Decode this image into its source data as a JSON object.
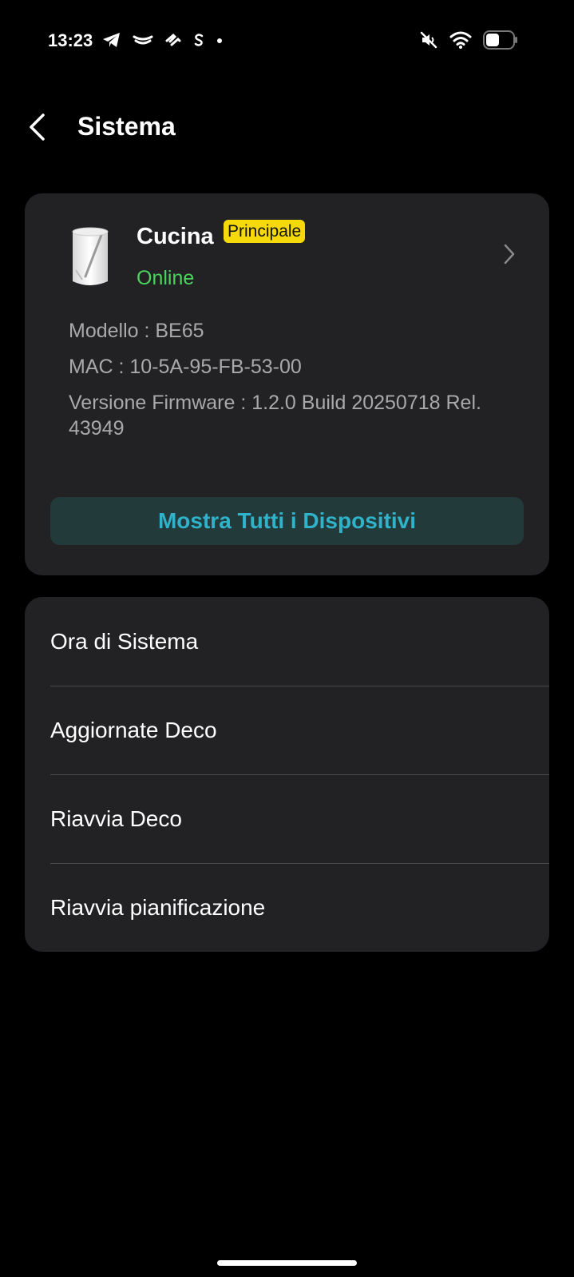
{
  "status_bar": {
    "time": "13:23",
    "left_icons": [
      "telegram-icon",
      "app-notification-icon",
      "app-notification-icon",
      "s-app-icon",
      "dot-icon"
    ],
    "right_icons": [
      "mute-icon",
      "wifi-icon",
      "battery-icon"
    ]
  },
  "header": {
    "title": "Sistema"
  },
  "device": {
    "name": "Cucina",
    "badge": "Principale",
    "status": "Online",
    "model": "Modello : BE65",
    "mac": "MAC : 10-5A-95-FB-53-00",
    "firmware": "Versione Firmware : 1.2.0 Build 20250718 Rel. 43949",
    "show_all_label": "Mostra Tutti i Dispositivi"
  },
  "settings": {
    "items": [
      {
        "label": "Ora di Sistema"
      },
      {
        "label": "Aggiornate Deco"
      },
      {
        "label": "Riavvia Deco"
      },
      {
        "label": "Riavvia pianificazione"
      }
    ]
  },
  "colors": {
    "background": "#000000",
    "card": "#222224",
    "online": "#4cd35e",
    "badge": "#f5d90a",
    "accent": "#2fb2ca",
    "button_bg": "#233a3b"
  }
}
